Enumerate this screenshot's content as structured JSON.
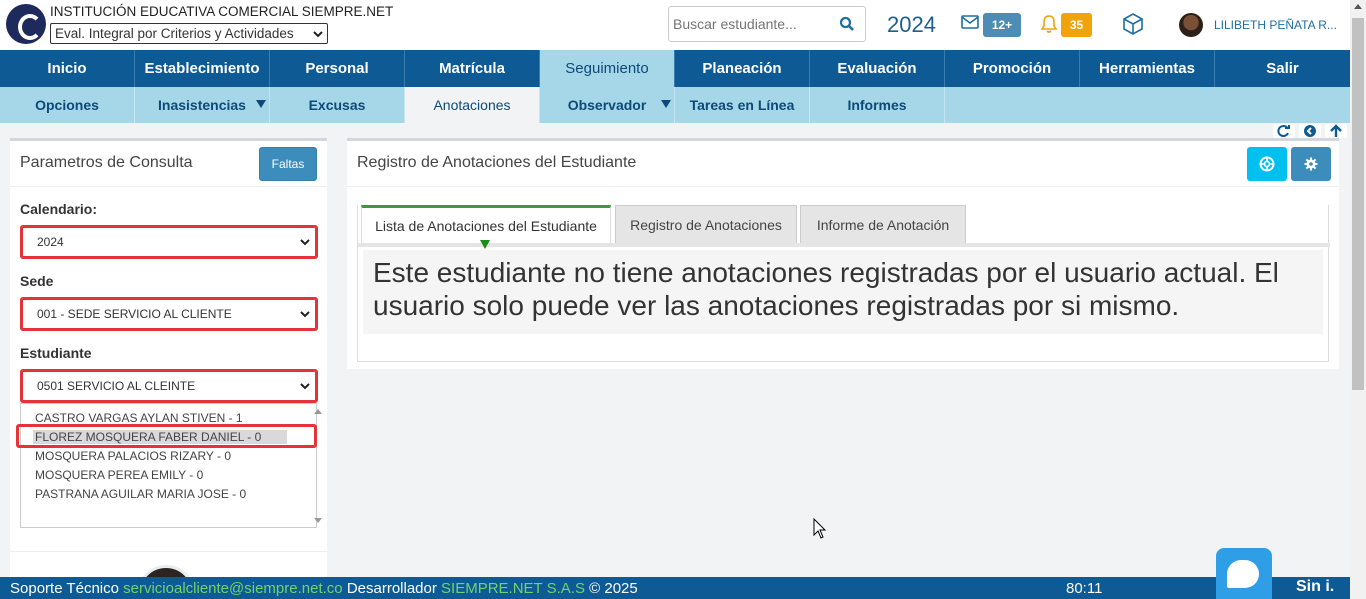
{
  "header": {
    "institution": "INSTITUCIÓN EDUCATIVA COMERCIAL SIEMPRE.NET",
    "eval_mode": "Eval. Integral por Criterios y Actividades",
    "search_placeholder": "Buscar estudiante...",
    "year": "2024",
    "messages_count": "12+",
    "notifications_count": "35",
    "user_name": "LILIBETH PEÑATA R..."
  },
  "main_nav": [
    "Inicio",
    "Establecimiento",
    "Personal",
    "Matrícula",
    "Seguimiento",
    "Planeación",
    "Evaluación",
    "Promoción",
    "Herramientas",
    "Salir"
  ],
  "sub_nav": [
    "Opciones",
    "Inasistencias",
    "Excusas",
    "Anotaciones",
    "Observador",
    "Tareas en Línea",
    "Informes"
  ],
  "left_panel": {
    "title": "Parametros de Consulta",
    "faltas_button": "Faltas",
    "calendar_label": "Calendario:",
    "calendar_value": "2024",
    "sede_label": "Sede",
    "sede_value": "001 - SEDE SERVICIO AL CLIENTE",
    "student_label": "Estudiante",
    "group_value": "0501 SERVICIO AL CLEINTE",
    "students": [
      "CASTRO VARGAS AYLAN STIVEN - 1",
      "FLOREZ MOSQUERA FABER DANIEL - 0",
      "MOSQUERA PALACIOS RIZARY - 0",
      "MOSQUERA PEREA EMILY - 0",
      "PASTRANA AGUILAR MARIA JOSE - 0"
    ]
  },
  "right_panel": {
    "title": "Registro de Anotaciones del Estudiante",
    "tabs": [
      "Lista de Anotaciones del Estudiante",
      "Registro de Anotaciones",
      "Informe de Anotación"
    ],
    "message": "Este estudiante no tiene anotaciones registradas por el usuario actual. El usuario solo puede ver las anotaciones registradas por si mismo."
  },
  "footer": {
    "support_label": "Soporte Técnico",
    "support_email": "servicioalcliente@siempre.net.co",
    "developer_label": "Desarrollador",
    "developer_name": "SIEMPRE.NET S.A.S",
    "copyright": "© 2025",
    "time": "80:11",
    "brand": "Sin i."
  },
  "colors": {
    "nav_blue": "#0d5a94",
    "subnav_light": "#a6d7e8",
    "highlight_red": "#e4343a",
    "tab_green": "#3a9a3a"
  }
}
